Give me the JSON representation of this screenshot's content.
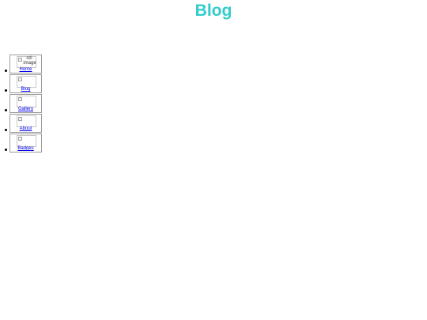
{
  "header": {
    "title": "Blog",
    "title_color": "#33cccc"
  },
  "nav": {
    "items": [
      {
        "label": "Home",
        "image_alt": "cd-image"
      },
      {
        "label": "Blog",
        "image_alt": ""
      },
      {
        "label": "Gallery",
        "image_alt": ""
      },
      {
        "label": "About",
        "image_alt": ""
      },
      {
        "label": "Badges",
        "image_alt": ""
      }
    ],
    "link_color": "#0000ee"
  }
}
